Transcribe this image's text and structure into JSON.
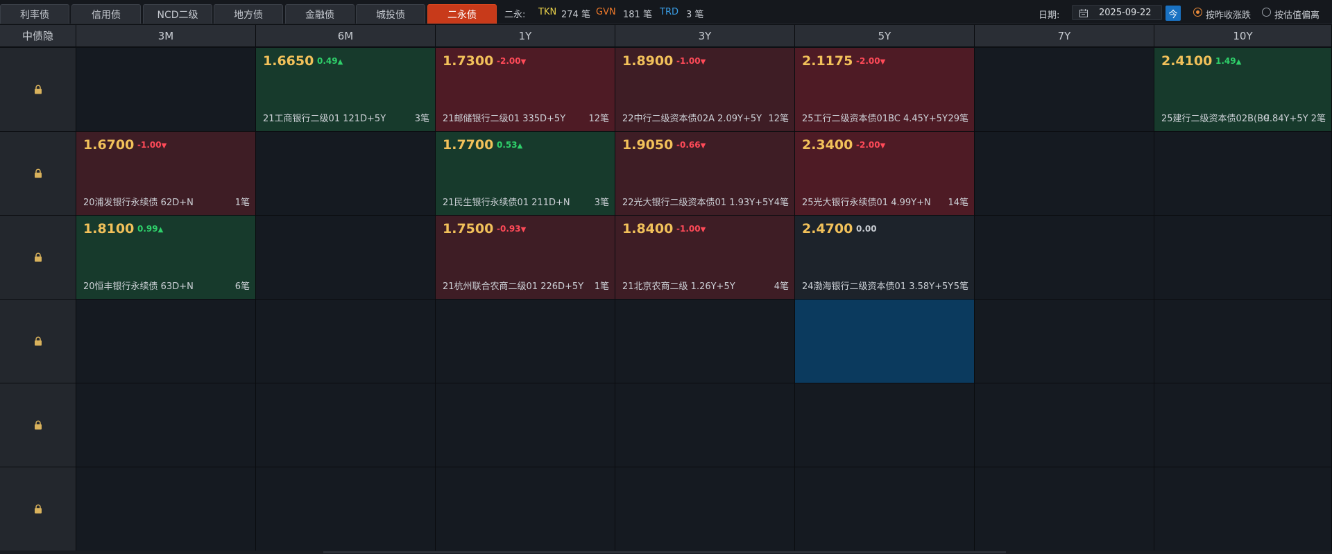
{
  "tabs": [
    {
      "label": "利率债"
    },
    {
      "label": "信用债"
    },
    {
      "label": "NCD二级"
    },
    {
      "label": "地方债"
    },
    {
      "label": "金融债"
    },
    {
      "label": "城投债"
    },
    {
      "label": "二永债",
      "active": true
    }
  ],
  "stats": {
    "prefix": "二永:",
    "items": [
      {
        "key": "TKN",
        "value": "274 笔",
        "color": "#e8d04a"
      },
      {
        "key": "GVN",
        "value": "181 笔",
        "color": "#f07a2a"
      },
      {
        "key": "TRD",
        "value": "3 笔",
        "color": "#3a9fe8"
      }
    ]
  },
  "date": {
    "label": "日期:",
    "value": "2025-09-22",
    "today_label": "今"
  },
  "sort_options": [
    {
      "label": "按昨收涨跌",
      "selected": true
    },
    {
      "label": "按估值偏离",
      "selected": false
    }
  ],
  "grid": {
    "corner_label": "中债隐",
    "columns": [
      "3M",
      "6M",
      "1Y",
      "3Y",
      "5Y",
      "7Y",
      "10Y"
    ],
    "row_icon": "lock-icon",
    "rows": [
      [
        null,
        {
          "price": "1.6650",
          "change": "0.49",
          "dir": "up",
          "bond": "21工商银行二级01 121D+5Y",
          "count": "3笔"
        },
        {
          "price": "1.7300",
          "change": "-2.00",
          "dir": "down",
          "bond": "21邮储银行二级01 335D+5Y",
          "count": "12笔"
        },
        {
          "price": "1.8900",
          "change": "-1.00",
          "dir": "down2",
          "bond": "22中行二级资本债02A 2.09Y+5Y",
          "count": "12笔"
        },
        {
          "price": "2.1175",
          "change": "-2.00",
          "dir": "down",
          "bond": "25工行二级资本债01BC 4.45Y+5Y",
          "count": "29笔"
        },
        null,
        {
          "price": "2.4100",
          "change": "1.49",
          "dir": "up",
          "bond": "25建行二级资本债02B(BC",
          "count": "9.84Y+5Y 2笔"
        }
      ],
      [
        {
          "price": "1.6700",
          "change": "-1.00",
          "dir": "down2",
          "bond": "20浦发银行永续债 62D+N",
          "count": "1笔"
        },
        null,
        {
          "price": "1.7700",
          "change": "0.53",
          "dir": "up",
          "bond": "21民生银行永续债01 211D+N",
          "count": "3笔"
        },
        {
          "price": "1.9050",
          "change": "-0.66",
          "dir": "down2",
          "bond": "22光大银行二级资本债01 1.93Y+5Y",
          "count": "4笔"
        },
        {
          "price": "2.3400",
          "change": "-2.00",
          "dir": "down",
          "bond": "25光大银行永续债01 4.99Y+N",
          "count": "14笔"
        },
        null,
        null
      ],
      [
        {
          "price": "1.8100",
          "change": "0.99",
          "dir": "up",
          "bond": "20恒丰银行永续债 63D+N",
          "count": "6笔"
        },
        null,
        {
          "price": "1.7500",
          "change": "-0.93",
          "dir": "down2",
          "bond": "21杭州联合农商二级01 226D+5Y",
          "count": "1笔"
        },
        {
          "price": "1.8400",
          "change": "-1.00",
          "dir": "down2",
          "bond": "21北京农商二级 1.26Y+5Y",
          "count": "4笔"
        },
        {
          "price": "2.4700",
          "change": "0.00",
          "dir": "neutral",
          "bond": "24渤海银行二级资本债01 3.58Y+5Y",
          "count": "5笔"
        },
        null,
        null
      ],
      [
        null,
        null,
        null,
        null,
        {
          "selected": true
        },
        null,
        null
      ],
      [
        null,
        null,
        null,
        null,
        null,
        null,
        null
      ],
      [
        null,
        null,
        null,
        null,
        null,
        null,
        null
      ]
    ]
  },
  "colors": {
    "up": "#2fd06a",
    "down": "#ff4a58",
    "price": "#f2c15a",
    "active_tab": "#c83a1a",
    "selected_cell": "#0b3a5e"
  }
}
